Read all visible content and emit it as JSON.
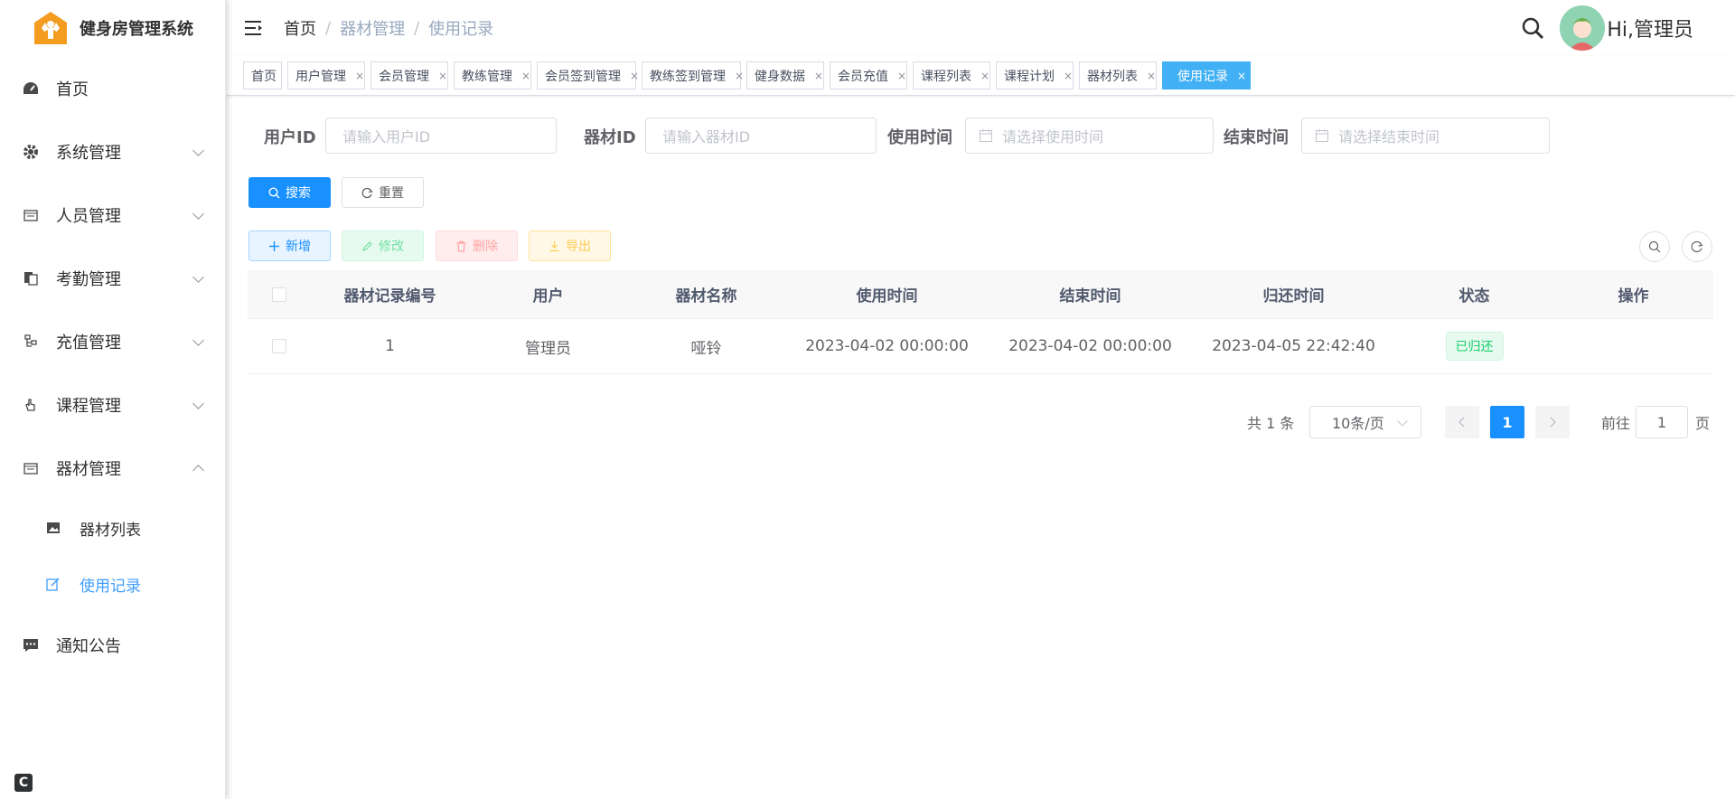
{
  "app": {
    "title": "健身房管理系统"
  },
  "sidebar": {
    "items": [
      {
        "label": "首页",
        "icon": "dashboard-icon"
      },
      {
        "label": "系统管理",
        "icon": "gear-icon"
      },
      {
        "label": "人员管理",
        "icon": "calendar-icon"
      },
      {
        "label": "考勤管理",
        "icon": "document-icon"
      },
      {
        "label": "充值管理",
        "icon": "tree-icon"
      },
      {
        "label": "课程管理",
        "icon": "hand-icon"
      },
      {
        "label": "器材管理",
        "icon": "calendar-icon"
      },
      {
        "label": "通知公告",
        "icon": "message-icon"
      }
    ],
    "sub_items": [
      {
        "label": "器材列表",
        "icon": "image-icon"
      },
      {
        "label": "使用记录",
        "icon": "edit-icon",
        "active": true
      }
    ]
  },
  "header": {
    "breadcrumb": [
      "首页",
      "器材管理",
      "使用记录"
    ],
    "separator": "/",
    "greeting": "Hi,管理员"
  },
  "tags": [
    "首页",
    "用户管理",
    "会员管理",
    "教练管理",
    "会员签到管理",
    "教练签到管理",
    "健身数据",
    "会员充值",
    "课程列表",
    "课程计划",
    "器材列表",
    "使用记录"
  ],
  "tag_close": "×",
  "search_form": {
    "user_id": {
      "label": "用户ID",
      "placeholder": "请输入用户ID"
    },
    "equipment_id": {
      "label": "器材ID",
      "placeholder": "请输入器材ID"
    },
    "use_time": {
      "label": "使用时间",
      "placeholder": "请选择使用时间"
    },
    "end_time": {
      "label": "结束时间",
      "placeholder": "请选择结束时间"
    },
    "search_label": "搜索",
    "reset_label": "重置"
  },
  "toolbar": {
    "add_label": "新增",
    "edit_label": "修改",
    "delete_label": "删除",
    "export_label": "导出"
  },
  "table": {
    "columns": [
      "器材记录编号",
      "用户",
      "器材名称",
      "使用时间",
      "结束时间",
      "归还时间",
      "状态",
      "操作"
    ],
    "rows": [
      {
        "id": "1",
        "user": "管理员",
        "equipment": "哑铃",
        "use_time": "2023-04-02 00:00:00",
        "end_time": "2023-04-02 00:00:00",
        "return_time": "2023-04-05 22:42:40",
        "status": "已归还",
        "actions": ""
      }
    ]
  },
  "pagination": {
    "total_text": "共 1 条",
    "page_size": "10条/页",
    "current_page": "1",
    "goto_prefix": "前往",
    "goto_value": "1",
    "goto_suffix": "页"
  },
  "colors": {
    "primary": "#1890ff",
    "active_tag": "#42b0f5",
    "success": "#13ce66",
    "logo": "#f39c1f"
  }
}
